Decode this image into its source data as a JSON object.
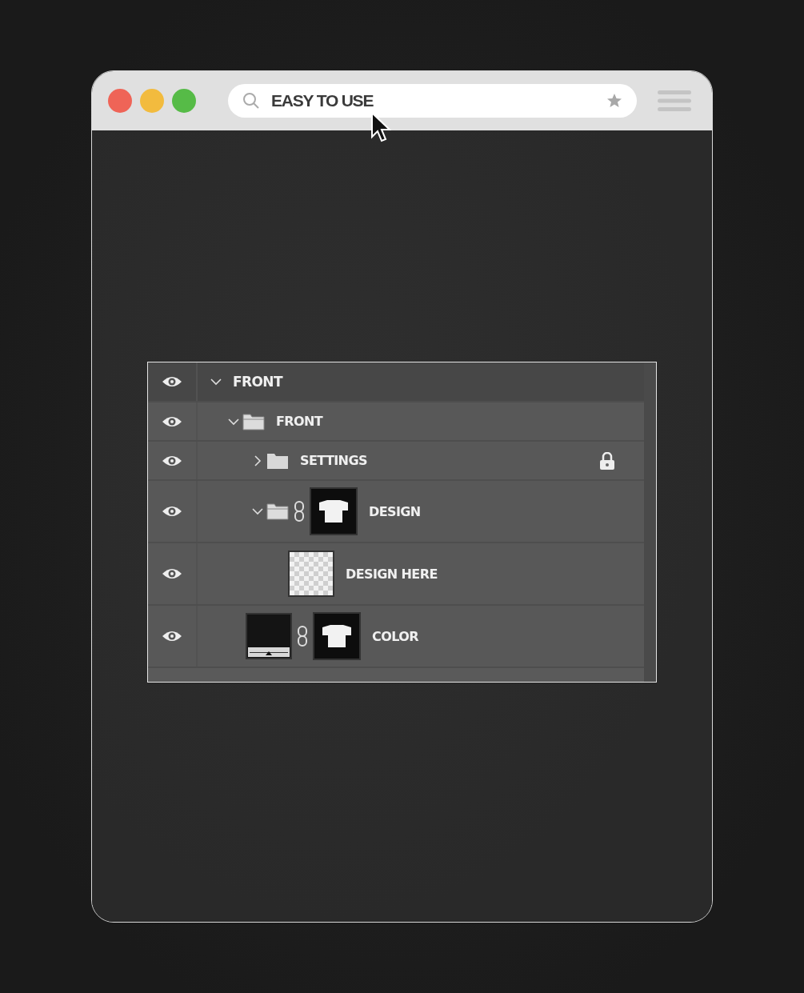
{
  "browser": {
    "address": "EASY TO USE"
  },
  "layers": [
    {
      "kind": "root",
      "name": "FRONT",
      "visible": true,
      "expanded": true,
      "locked": false,
      "masked": false,
      "children": [
        {
          "kind": "folder",
          "name": "FRONT",
          "visible": true,
          "expanded": true,
          "locked": false,
          "masked": false,
          "children": [
            {
              "kind": "folder",
              "name": "SETTINGS",
              "visible": true,
              "expanded": false,
              "locked": true,
              "masked": false
            },
            {
              "kind": "folder",
              "name": "DESIGN",
              "visible": true,
              "expanded": true,
              "locked": false,
              "masked": true,
              "children": [
                {
                  "kind": "layer",
                  "name": "DESIGN HERE",
                  "visible": true,
                  "locked": false,
                  "masked": false
                }
              ]
            },
            {
              "kind": "fill",
              "name": "COLOR",
              "visible": true,
              "locked": false,
              "masked": true
            }
          ]
        }
      ]
    }
  ]
}
